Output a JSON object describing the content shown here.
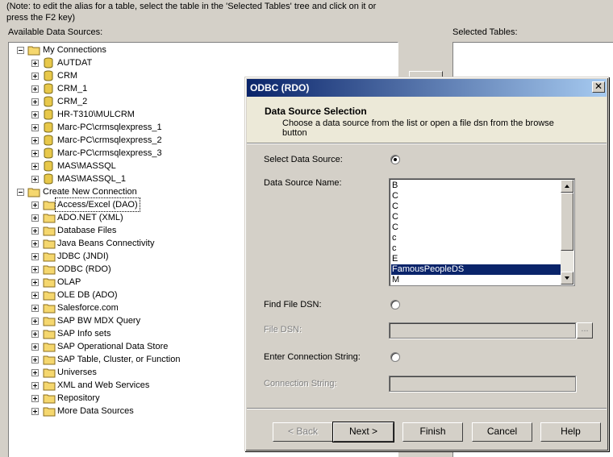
{
  "note": "(Note: to edit the alias for a table, select the table in the 'Selected Tables' tree and click on it or press the F2 key)",
  "available_label": "Available Data Sources:",
  "selected_label": "Selected Tables:",
  "tree": {
    "my_connections": "My Connections",
    "connections": [
      "AUTDAT",
      "CRM",
      "CRM_1",
      "CRM_2",
      "HR-T310\\MULCRM",
      "Marc-PC\\crmsqlexpress_1",
      "Marc-PC\\crmsqlexpress_2",
      "Marc-PC\\crmsqlexpress_3",
      "MAS\\MASSQL",
      "MAS\\MASSQL_1"
    ],
    "create_new": "Create New Connection",
    "types": [
      "Access/Excel (DAO)",
      "ADO.NET (XML)",
      "Database Files",
      "Java Beans Connectivity",
      "JDBC (JNDI)",
      "ODBC (RDO)",
      "OLAP",
      "OLE DB (ADO)",
      "Salesforce.com",
      "SAP BW MDX Query",
      "SAP Info sets",
      "SAP Operational Data Store",
      "SAP Table, Cluster, or Function",
      "Universes",
      "XML and Web Services",
      "Repository",
      "More Data Sources"
    ]
  },
  "dialog": {
    "title": "ODBC (RDO)",
    "close_glyph": "✕",
    "header_title": "Data Source Selection",
    "header_desc": "Choose a data source from the list or open a file dsn from the browse button",
    "select_ds_label": "Select Data Source:",
    "ds_name_label": "Data Source Name:",
    "ds_list": [
      "B",
      "C",
      "C",
      "C",
      "C",
      "c",
      "c",
      "E",
      "FamousPeopleDS",
      "M"
    ],
    "ds_selected": "FamousPeopleDS",
    "find_file_label": "Find File DSN:",
    "file_dsn_label": "File DSN:",
    "browse_glyph": "...",
    "enter_conn_label": "Enter Connection String:",
    "conn_string_label": "Connection String:",
    "buttons": {
      "back": "< Back",
      "next": "Next >",
      "finish": "Finish",
      "cancel": "Cancel",
      "help": "Help"
    }
  },
  "colors": {
    "title_start": "#0a246a",
    "title_end": "#a6caf0",
    "selection": "#0a246a",
    "window_bg": "#d4d0c8",
    "header_bg": "#ece9d8"
  }
}
